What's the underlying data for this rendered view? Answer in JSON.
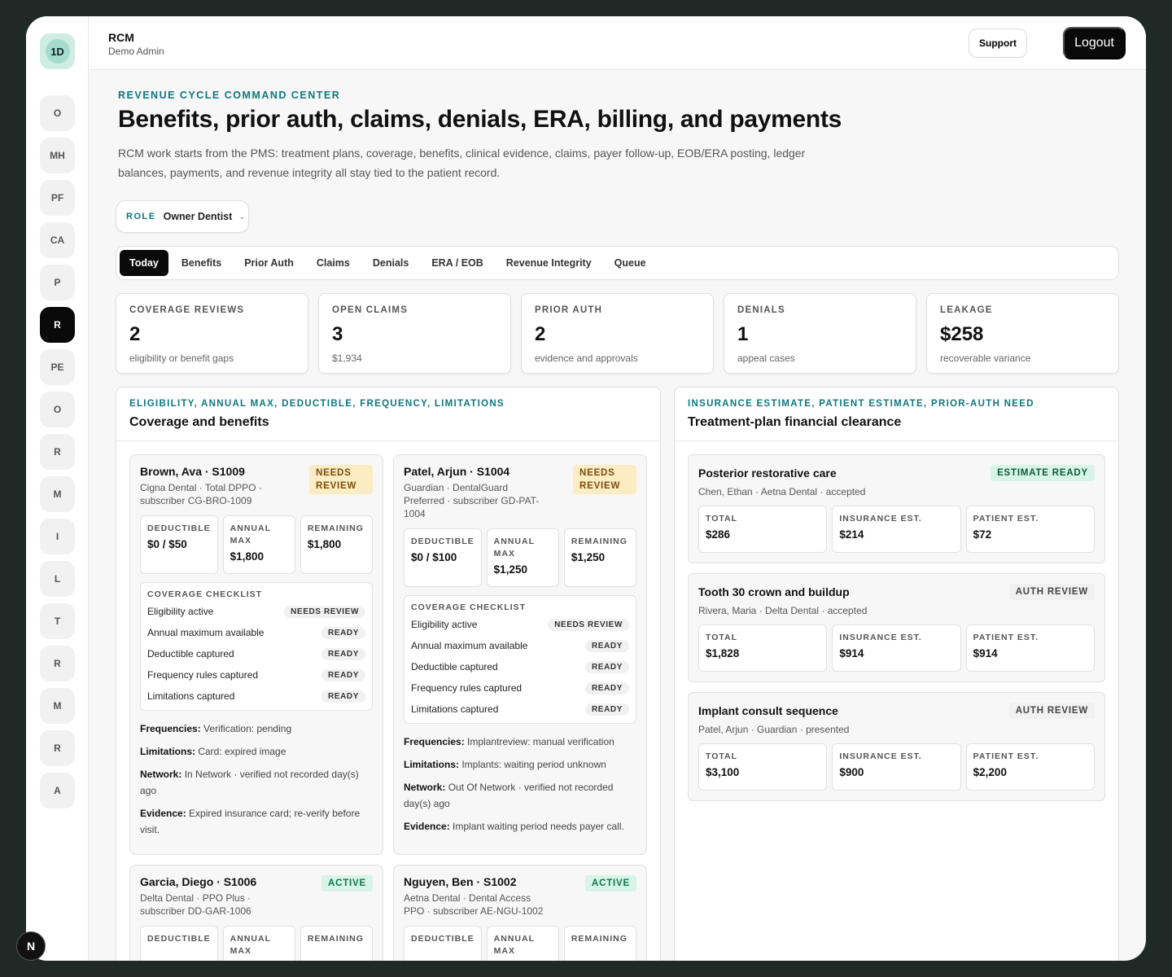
{
  "sidebar": {
    "logo": "1D",
    "items": [
      "O",
      "MH",
      "PF",
      "CA",
      "P",
      "R",
      "PE",
      "O",
      "R",
      "M",
      "I",
      "L",
      "T",
      "R",
      "M",
      "R",
      "A"
    ],
    "active_index": 5
  },
  "header": {
    "title": "RCM",
    "subtitle": "Demo Admin",
    "support": "Support",
    "logout": "Logout"
  },
  "page": {
    "eyebrow": "REVENUE CYCLE COMMAND CENTER",
    "title": "Benefits, prior auth, claims, denials, ERA, billing, and payments",
    "intro": "RCM work starts from the PMS: treatment plans, coverage, benefits, clinical evidence, claims, payer follow-up, EOB/ERA posting, ledger balances, payments, and revenue integrity all stay tied to the patient record."
  },
  "role": {
    "label": "ROLE",
    "value": "Owner Dentist"
  },
  "tabs": [
    "Today",
    "Benefits",
    "Prior Auth",
    "Claims",
    "Denials",
    "ERA / EOB",
    "Revenue Integrity",
    "Queue"
  ],
  "stats": [
    {
      "label": "COVERAGE REVIEWS",
      "value": "2",
      "sub": "eligibility or benefit gaps"
    },
    {
      "label": "OPEN CLAIMS",
      "value": "3",
      "sub": "$1,934"
    },
    {
      "label": "PRIOR AUTH",
      "value": "2",
      "sub": "evidence and approvals"
    },
    {
      "label": "DENIALS",
      "value": "1",
      "sub": "appeal cases"
    },
    {
      "label": "LEAKAGE",
      "value": "$258",
      "sub": "recoverable variance"
    }
  ],
  "coverage": {
    "eyebrow": "ELIGIBILITY, ANNUAL MAX, DEDUCTIBLE, FREQUENCY, LIMITATIONS",
    "title": "Coverage and benefits",
    "amount_labels": {
      "deductible": "DEDUCTIBLE",
      "annual_max": "ANNUAL MAX",
      "remaining": "REMAINING"
    },
    "checklist_title": "COVERAGE CHECKLIST",
    "cards": [
      {
        "name": "Brown, Ava · S1009",
        "status": "NEEDS REVIEW",
        "plan": "Cigna Dental · Total DPPO · subscriber CG-BRO-1009",
        "deductible": "$0 / $50",
        "annual_max": "$1,800",
        "remaining": "$1,800",
        "checklist": [
          {
            "label": "Eligibility active",
            "status": "NEEDS REVIEW"
          },
          {
            "label": "Annual maximum available",
            "status": "READY"
          },
          {
            "label": "Deductible captured",
            "status": "READY"
          },
          {
            "label": "Frequency rules captured",
            "status": "READY"
          },
          {
            "label": "Limitations captured",
            "status": "READY"
          }
        ],
        "frequencies": "Verification: pending",
        "limitations": "Card: expired image",
        "network": "In Network · verified not recorded day(s) ago",
        "evidence": "Expired insurance card; re-verify before visit."
      },
      {
        "name": "Patel, Arjun · S1004",
        "status": "NEEDS REVIEW",
        "plan": "Guardian · DentalGuard Preferred · subscriber GD-PAT-1004",
        "deductible": "$0 / $100",
        "annual_max": "$1,250",
        "remaining": "$1,250",
        "checklist": [
          {
            "label": "Eligibility active",
            "status": "NEEDS REVIEW"
          },
          {
            "label": "Annual maximum available",
            "status": "READY"
          },
          {
            "label": "Deductible captured",
            "status": "READY"
          },
          {
            "label": "Frequency rules captured",
            "status": "READY"
          },
          {
            "label": "Limitations captured",
            "status": "READY"
          }
        ],
        "frequencies": "Implantreview: manual verification",
        "limitations": "Implants: waiting period unknown",
        "network": "Out Of Network · verified not recorded day(s) ago",
        "evidence": "Implant waiting period needs payer call."
      },
      {
        "name": "Garcia, Diego · S1006",
        "status": "ACTIVE",
        "plan": "Delta Dental · PPO Plus · subscriber DD-GAR-1006"
      },
      {
        "name": "Nguyen, Ben · S1002",
        "status": "ACTIVE",
        "plan": "Aetna Dental · Dental Access PPO · subscriber AE-NGU-1002"
      }
    ],
    "note_labels": {
      "frequencies": "Frequencies:",
      "limitations": "Limitations:",
      "network": "Network:",
      "evidence": "Evidence:"
    }
  },
  "estimates": {
    "eyebrow": "INSURANCE ESTIMATE, PATIENT ESTIMATE, PRIOR-AUTH NEED",
    "title": "Treatment-plan financial clearance",
    "amount_labels": {
      "total": "TOTAL",
      "insurance": "INSURANCE EST.",
      "patient": "PATIENT EST."
    },
    "cards": [
      {
        "name": "Posterior restorative care",
        "status": "ESTIMATE READY",
        "sub": "Chen, Ethan · Aetna Dental · accepted",
        "total": "$286",
        "insurance": "$214",
        "patient": "$72"
      },
      {
        "name": "Tooth 30 crown and buildup",
        "status": "AUTH REVIEW",
        "sub": "Rivera, Maria · Delta Dental · accepted",
        "total": "$1,828",
        "insurance": "$914",
        "patient": "$914"
      },
      {
        "name": "Implant consult sequence",
        "status": "AUTH REVIEW",
        "sub": "Patel, Arjun · Guardian · presented",
        "total": "$3,100",
        "insurance": "$900",
        "patient": "$2,200"
      }
    ]
  },
  "dev_badge": "N"
}
